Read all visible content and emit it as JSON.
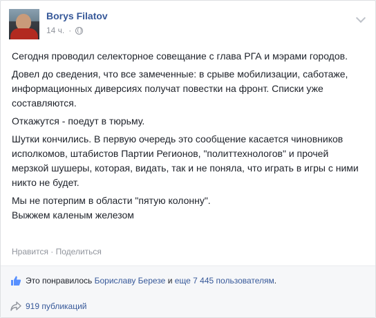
{
  "post": {
    "author": "Borys Filatov",
    "time": "14 ч.",
    "time_separator": "·",
    "paragraphs": [
      "Сегодня проводил селекторное совещание с глава РГА и мэрами городов.",
      "Довел до сведения, что все замеченные: в срыве мобилизации, саботаже, информационных диверсиях получат повестки на фронт. Списки уже составляются.",
      "Откажутся - поедут в тюрьму.",
      "Шутки кончились. В первую очередь это сообщение касается чиновников исполкомов, штабистов Партии Регионов, \"политтехнологов\" и прочей мерзкой шушеры, которая, видать, так и не поняла, что играть в игры с ними никто не будет.",
      "Мы не потерпим в области \"пятую колонну\".",
      "Выжжем каленым железом"
    ]
  },
  "actions": {
    "like_label": "Нравится",
    "separator": "·",
    "share_label": "Поделиться"
  },
  "likes": {
    "prefix": "Это понравилось",
    "name": "Бориславу Березе",
    "conjunction": "и",
    "others": "еще 7 445 пользователям",
    "suffix": "."
  },
  "shares": {
    "label": "919 публикаций"
  },
  "icons": {
    "globe": "globe-icon",
    "chevron": "chevron-down-icon",
    "thumb": "thumbs-up-icon",
    "share": "share-arrow-icon"
  },
  "colors": {
    "link": "#365899",
    "muted": "#90949c",
    "footer_bg": "#f6f7f9"
  }
}
